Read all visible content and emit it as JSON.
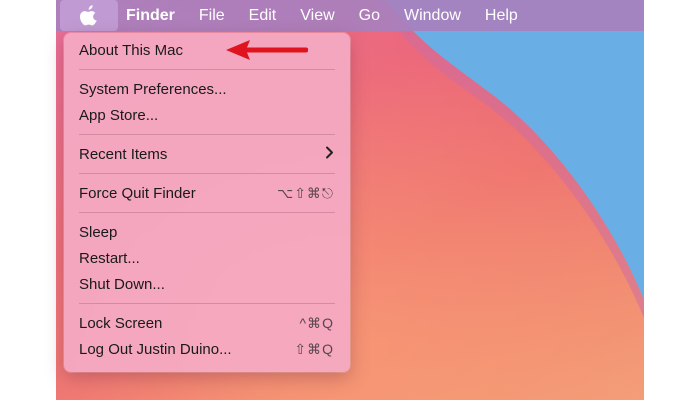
{
  "menubar": {
    "apple_icon": "apple-logo-icon",
    "items": [
      {
        "label": "Finder",
        "bold": true
      },
      {
        "label": "File"
      },
      {
        "label": "Edit"
      },
      {
        "label": "View"
      },
      {
        "label": "Go"
      },
      {
        "label": "Window"
      },
      {
        "label": "Help"
      }
    ]
  },
  "apple_menu": {
    "items": {
      "about": {
        "label": "About This Mac"
      },
      "system_preferences": {
        "label": "System Preferences..."
      },
      "app_store": {
        "label": "App Store..."
      },
      "recent_items": {
        "label": "Recent Items",
        "submenu_icon": "chevron-right-icon"
      },
      "force_quit": {
        "label": "Force Quit Finder",
        "shortcut": "⌥⇧⌘⎋"
      },
      "sleep": {
        "label": "Sleep"
      },
      "restart": {
        "label": "Restart..."
      },
      "shut_down": {
        "label": "Shut Down..."
      },
      "lock_screen": {
        "label": "Lock Screen",
        "shortcut": "^⌘Q"
      },
      "log_out": {
        "label": "Log Out Justin Duino...",
        "shortcut": "⇧⌘Q"
      }
    }
  },
  "colors": {
    "annotation_arrow": "#e0141e",
    "menubar_bg": "#a880be",
    "menu_bg": "#f4aac4"
  }
}
